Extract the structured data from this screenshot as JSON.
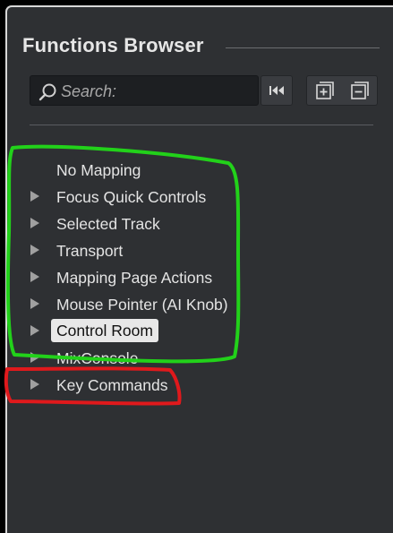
{
  "panel": {
    "title": "Functions Browser"
  },
  "search": {
    "placeholder": "Search:"
  },
  "toolbar": {
    "reset_icon": "skip-to-start-icon",
    "expand_icon": "expand-all-icon",
    "collapse_icon": "collapse-all-icon"
  },
  "tree": {
    "items": [
      {
        "label": "No Mapping",
        "expandable": false,
        "selected": false
      },
      {
        "label": "Focus Quick Controls",
        "expandable": true,
        "selected": false
      },
      {
        "label": "Selected Track",
        "expandable": true,
        "selected": false
      },
      {
        "label": "Transport",
        "expandable": true,
        "selected": false
      },
      {
        "label": "Mapping Page Actions",
        "expandable": true,
        "selected": false
      },
      {
        "label": "Mouse Pointer (AI Knob)",
        "expandable": true,
        "selected": false
      },
      {
        "label": "Control Room",
        "expandable": true,
        "selected": true
      },
      {
        "label": "MixConsole",
        "expandable": true,
        "selected": false
      },
      {
        "label": "Key Commands",
        "expandable": true,
        "selected": false
      }
    ]
  },
  "colors": {
    "panel_bg": "#2e3033",
    "annotation_green": "#22d11a",
    "annotation_red": "#e0191c"
  }
}
